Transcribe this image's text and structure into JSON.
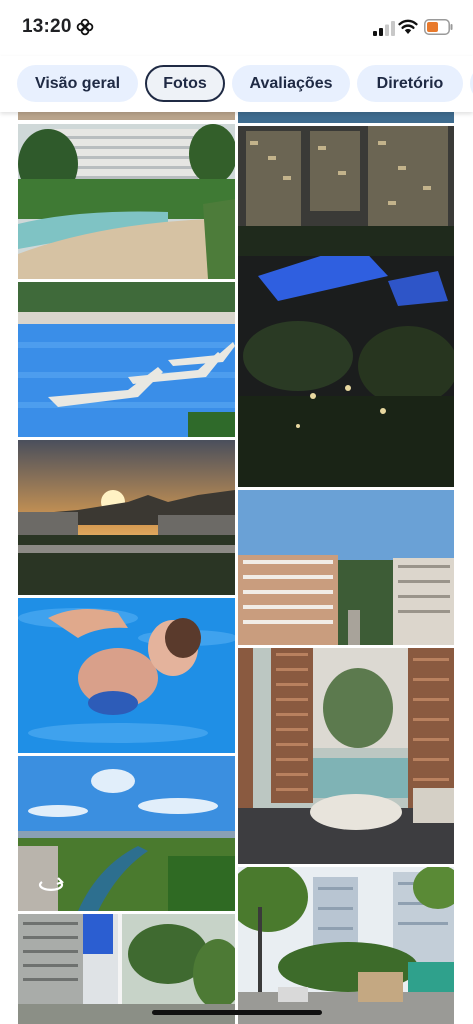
{
  "status_bar": {
    "time": "13:20",
    "icons": [
      "flower-icon",
      "signal-icon",
      "wifi-icon",
      "battery-icon"
    ],
    "battery_color": "#e8792b"
  },
  "tabs": [
    {
      "label": "Visão geral",
      "active": false
    },
    {
      "label": "Fotos",
      "active": true
    },
    {
      "label": "Avaliações",
      "active": false
    },
    {
      "label": "Diretório",
      "active": false
    }
  ],
  "photos": [
    {
      "subject": "pool-garden-day"
    },
    {
      "subject": "condo-night-aerial"
    },
    {
      "subject": "pool-loungers"
    },
    {
      "subject": "sunset-mountains"
    },
    {
      "subject": "city-aerial-day"
    },
    {
      "subject": "child-swimming-underwater"
    },
    {
      "subject": "pergola-lounge"
    },
    {
      "subject": "green-landscape-panorama",
      "overlay_icon": "panorama-360-icon"
    },
    {
      "subject": "palm-garden-buildings"
    },
    {
      "subject": "street-trees-buildings"
    }
  ],
  "colors": {
    "tab_bg": "#e8f0fe",
    "tab_text": "#1f2a44",
    "active_tab_border": "#1f2a44"
  }
}
